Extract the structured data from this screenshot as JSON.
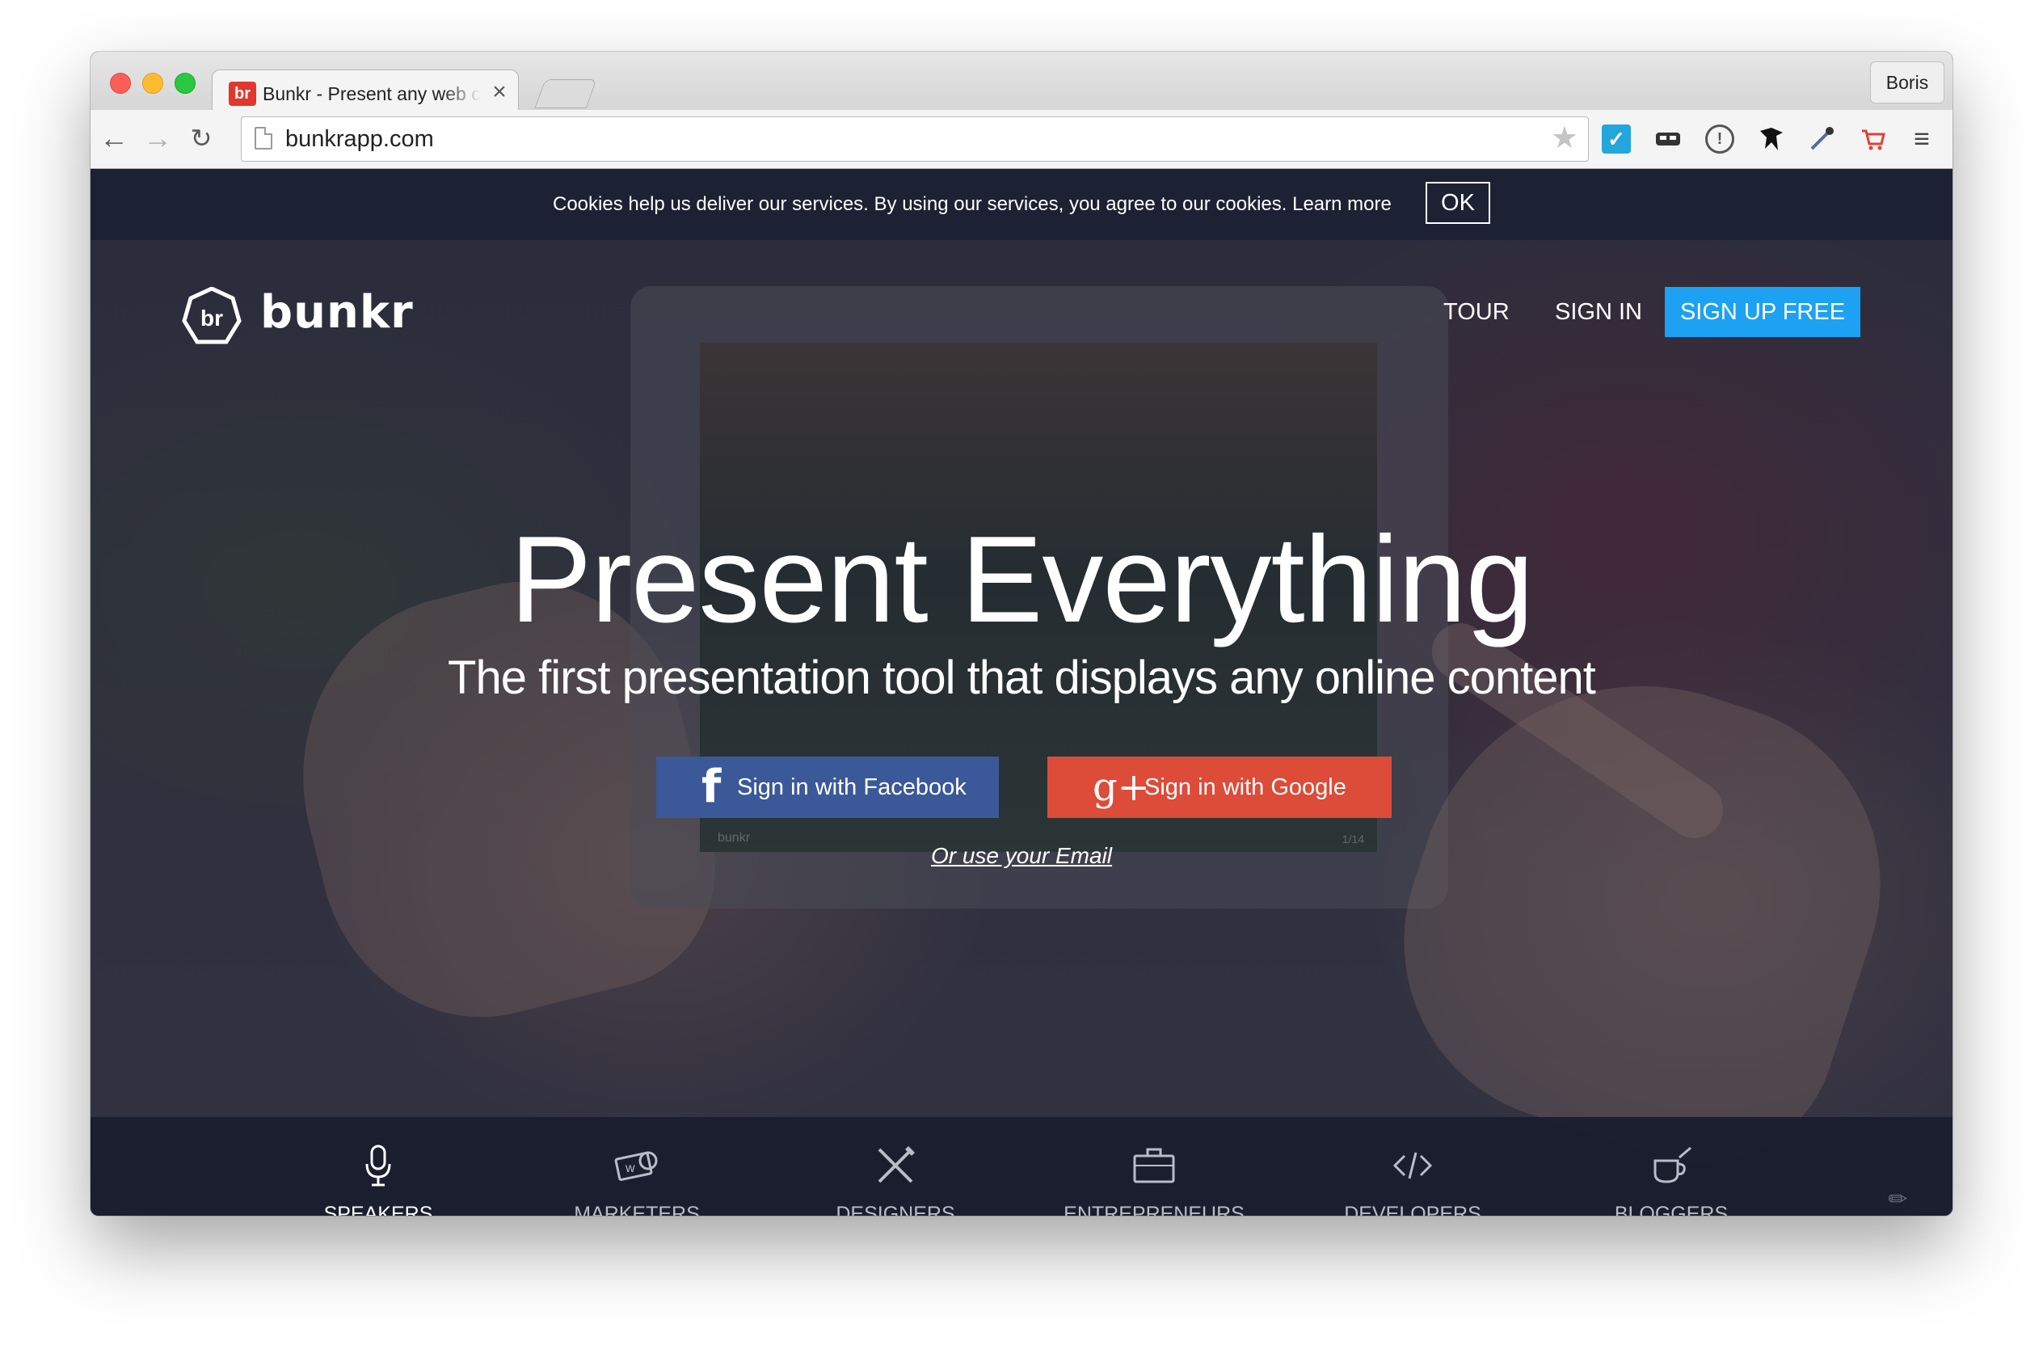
{
  "browser": {
    "tab_title": "Bunkr - Present any web content",
    "tab_favicon": "br",
    "profile_name": "Boris",
    "url": "bunkrapp.com",
    "extensions": [
      "checkmark-extension-icon",
      "mask-extension-icon",
      "one-password-extension-icon",
      "ninja-extension-icon",
      "eyedropper-extension-icon",
      "cart-extension-icon",
      "chrome-menu-icon"
    ]
  },
  "cookie_bar": {
    "text": "Cookies help us deliver our services. By using our services, you agree to our cookies. Learn more",
    "ok_label": "OK"
  },
  "header": {
    "logo_text": "bunkr",
    "logo_mark": "br",
    "nav": {
      "tour": "TOUR",
      "sign_in": "SIGN IN",
      "sign_up": "SIGN UP FREE"
    }
  },
  "hero": {
    "title": "Present Everything",
    "subtitle": "The first presentation tool that displays any online content",
    "facebook_icon": "f",
    "facebook_label": "Sign in with Facebook",
    "google_icon": "g+",
    "google_label": "Sign in with Google",
    "email_link": "Or use your Email",
    "tablet_brand": "bunkr",
    "tablet_page": "1/14"
  },
  "audiences": [
    {
      "label": "SPEAKERS",
      "icon": "microphone-icon",
      "active": true
    },
    {
      "label": "MARKETERS",
      "icon": "money-icon",
      "active": false
    },
    {
      "label": "DESIGNERS",
      "icon": "design-tools-icon",
      "active": false
    },
    {
      "label": "ENTREPRENEURS",
      "icon": "briefcase-icon",
      "active": false
    },
    {
      "label": "DEVELOPERS",
      "icon": "code-icon",
      "active": false
    },
    {
      "label": "BLOGGERS",
      "icon": "coffee-cup-icon",
      "active": false
    }
  ],
  "colors": {
    "signup_blue": "#1da1f2",
    "facebook_blue": "#3b5998",
    "google_red": "#dd4b39",
    "cookie_bar_bg": "#1c2233"
  }
}
